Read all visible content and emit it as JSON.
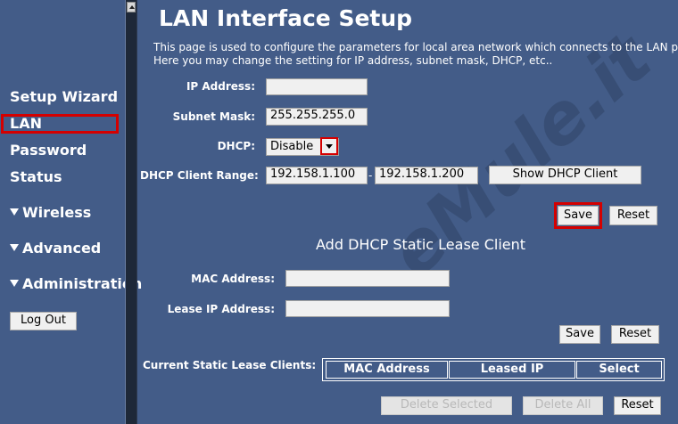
{
  "sidebar": {
    "items": [
      {
        "label": "Setup Wizard"
      },
      {
        "label": "LAN"
      },
      {
        "label": "Password"
      },
      {
        "label": "Status"
      },
      {
        "label": "Wireless"
      },
      {
        "label": "Advanced"
      },
      {
        "label": "Administration"
      }
    ],
    "logout_label": "Log Out"
  },
  "page": {
    "title": "LAN Interface Setup",
    "description_line1": "This page is used to configure the parameters for local area network which connects to the LAN p",
    "description_line2": "Here you may change the setting for IP address, subnet mask, DHCP, etc.."
  },
  "form": {
    "ip_address_label": "IP Address:",
    "ip_address_value": "",
    "subnet_mask_label": "Subnet Mask:",
    "subnet_mask_value": "255.255.255.0",
    "dhcp_label": "DHCP:",
    "dhcp_value": "Disable",
    "dhcp_range_label": "DHCP Client Range:",
    "dhcp_range_start": "192.158.1.100",
    "dhcp_range_separator": "-",
    "dhcp_range_end": "192.158.1.200",
    "show_dhcp_client_label": "Show DHCP Client",
    "save_label": "Save",
    "reset_label": "Reset"
  },
  "static_lease": {
    "title": "Add DHCP Static Lease Client",
    "mac_label": "MAC Address:",
    "mac_value": "",
    "lease_ip_label": "Lease IP Address:",
    "lease_ip_value": "",
    "save_label": "Save",
    "reset_label": "Reset",
    "current_label": "Current Static Lease Clients:",
    "columns": [
      "MAC Address",
      "Leased IP",
      "Select"
    ],
    "delete_selected_label": "Delete Selected",
    "delete_all_label": "Delete All",
    "reset_bottom_label": "Reset"
  },
  "watermark": "eMule.it",
  "colors": {
    "background": "#435c88",
    "highlight": "#d40000"
  }
}
